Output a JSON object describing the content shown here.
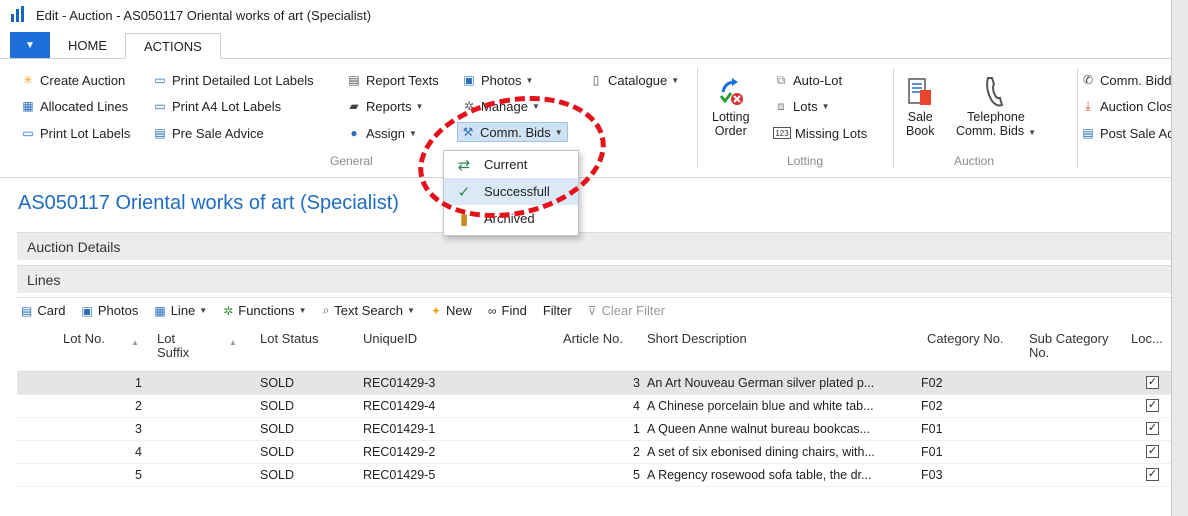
{
  "window": {
    "title": "Edit - Auction - AS050117 Oriental works of art (Specialist)"
  },
  "tabs": [
    {
      "label": "HOME",
      "active": false
    },
    {
      "label": "ACTIONS",
      "active": true
    }
  ],
  "ribbon": {
    "general": {
      "label": "General",
      "create_auction": "Create Auction",
      "allocated_lines": "Allocated Lines",
      "print_lot_labels": "Print Lot Labels",
      "print_detailed_lot_labels": "Print Detailed Lot Labels",
      "print_a4_lot_labels": "Print A4 Lot Labels",
      "pre_sale_advice": "Pre Sale Advice",
      "report_texts": "Report Texts",
      "reports": "Reports",
      "assign": "Assign",
      "photos": "Photos",
      "manage": "Manage",
      "comm_bids": "Comm. Bids",
      "catalogue": "Catalogue"
    },
    "lotting": {
      "label": "Lotting",
      "lotting_order_line1": "Lotting",
      "lotting_order_line2": "Order",
      "auto_lot": "Auto-Lot",
      "lots": "Lots",
      "missing_lots": "Missing Lots"
    },
    "auction": {
      "label": "Auction",
      "sale_book_line1": "Sale",
      "sale_book_line2": "Book",
      "telephone_line1": "Telephone",
      "telephone_line2": "Comm. Bids"
    },
    "right": {
      "comm_bidder": "Comm. Bidde",
      "auction_close": "Auction Close",
      "post_sale_advice": "Post Sale Adv"
    }
  },
  "comm_bids_menu": [
    {
      "label": "Current",
      "icon": "swap-arrows-icon"
    },
    {
      "label": "Successfull",
      "icon": "checkmark-icon",
      "hovered": true
    },
    {
      "label": "Archived",
      "icon": "archive-icon"
    }
  ],
  "page": {
    "title": "AS050117 Oriental works of art (Specialist)",
    "auction_details": "Auction Details",
    "lines": "Lines"
  },
  "lines_toolbar": {
    "card": "Card",
    "photos": "Photos",
    "line": "Line",
    "functions": "Functions",
    "text_search": "Text Search",
    "new": "New",
    "find": "Find",
    "filter": "Filter",
    "clear_filter": "Clear Filter"
  },
  "table": {
    "headers": {
      "lot_no": "Lot No.",
      "lot_suffix_1": "Lot",
      "lot_suffix_2": "Suffix",
      "lot_status": "Lot Status",
      "unique_id": "UniqueID",
      "article_no": "Article No.",
      "short_description": "Short Description",
      "category_no": "Category No.",
      "sub_category_1": "Sub Category",
      "sub_category_2": "No.",
      "loc": "Loc..."
    },
    "rows": [
      {
        "lot_no": "1",
        "lot_status": "SOLD",
        "unique_id": "REC01429-3",
        "article_no": "3",
        "short_description": "An Art Nouveau German silver plated p...",
        "category_no": "F02",
        "checked": true,
        "selected": true
      },
      {
        "lot_no": "2",
        "lot_status": "SOLD",
        "unique_id": "REC01429-4",
        "article_no": "4",
        "short_description": "A Chinese porcelain blue and white tab...",
        "category_no": "F02",
        "checked": true
      },
      {
        "lot_no": "3",
        "lot_status": "SOLD",
        "unique_id": "REC01429-1",
        "article_no": "1",
        "short_description": "A Queen Anne walnut bureau bookcas...",
        "category_no": "F01",
        "checked": true
      },
      {
        "lot_no": "4",
        "lot_status": "SOLD",
        "unique_id": "REC01429-2",
        "article_no": "2",
        "short_description": "A set of six ebonised dining chairs, with...",
        "category_no": "F01",
        "checked": true
      },
      {
        "lot_no": "5",
        "lot_status": "SOLD",
        "unique_id": "REC01429-5",
        "article_no": "5",
        "short_description": "A Regency rosewood sofa table, the dr...",
        "category_no": "F03",
        "checked": true
      }
    ]
  },
  "colors": {
    "accent": "#1f6cc2",
    "file_tab": "#1e6fd9",
    "highlight_circle": "#e3121b",
    "selected_row": "#e5e5e5"
  }
}
